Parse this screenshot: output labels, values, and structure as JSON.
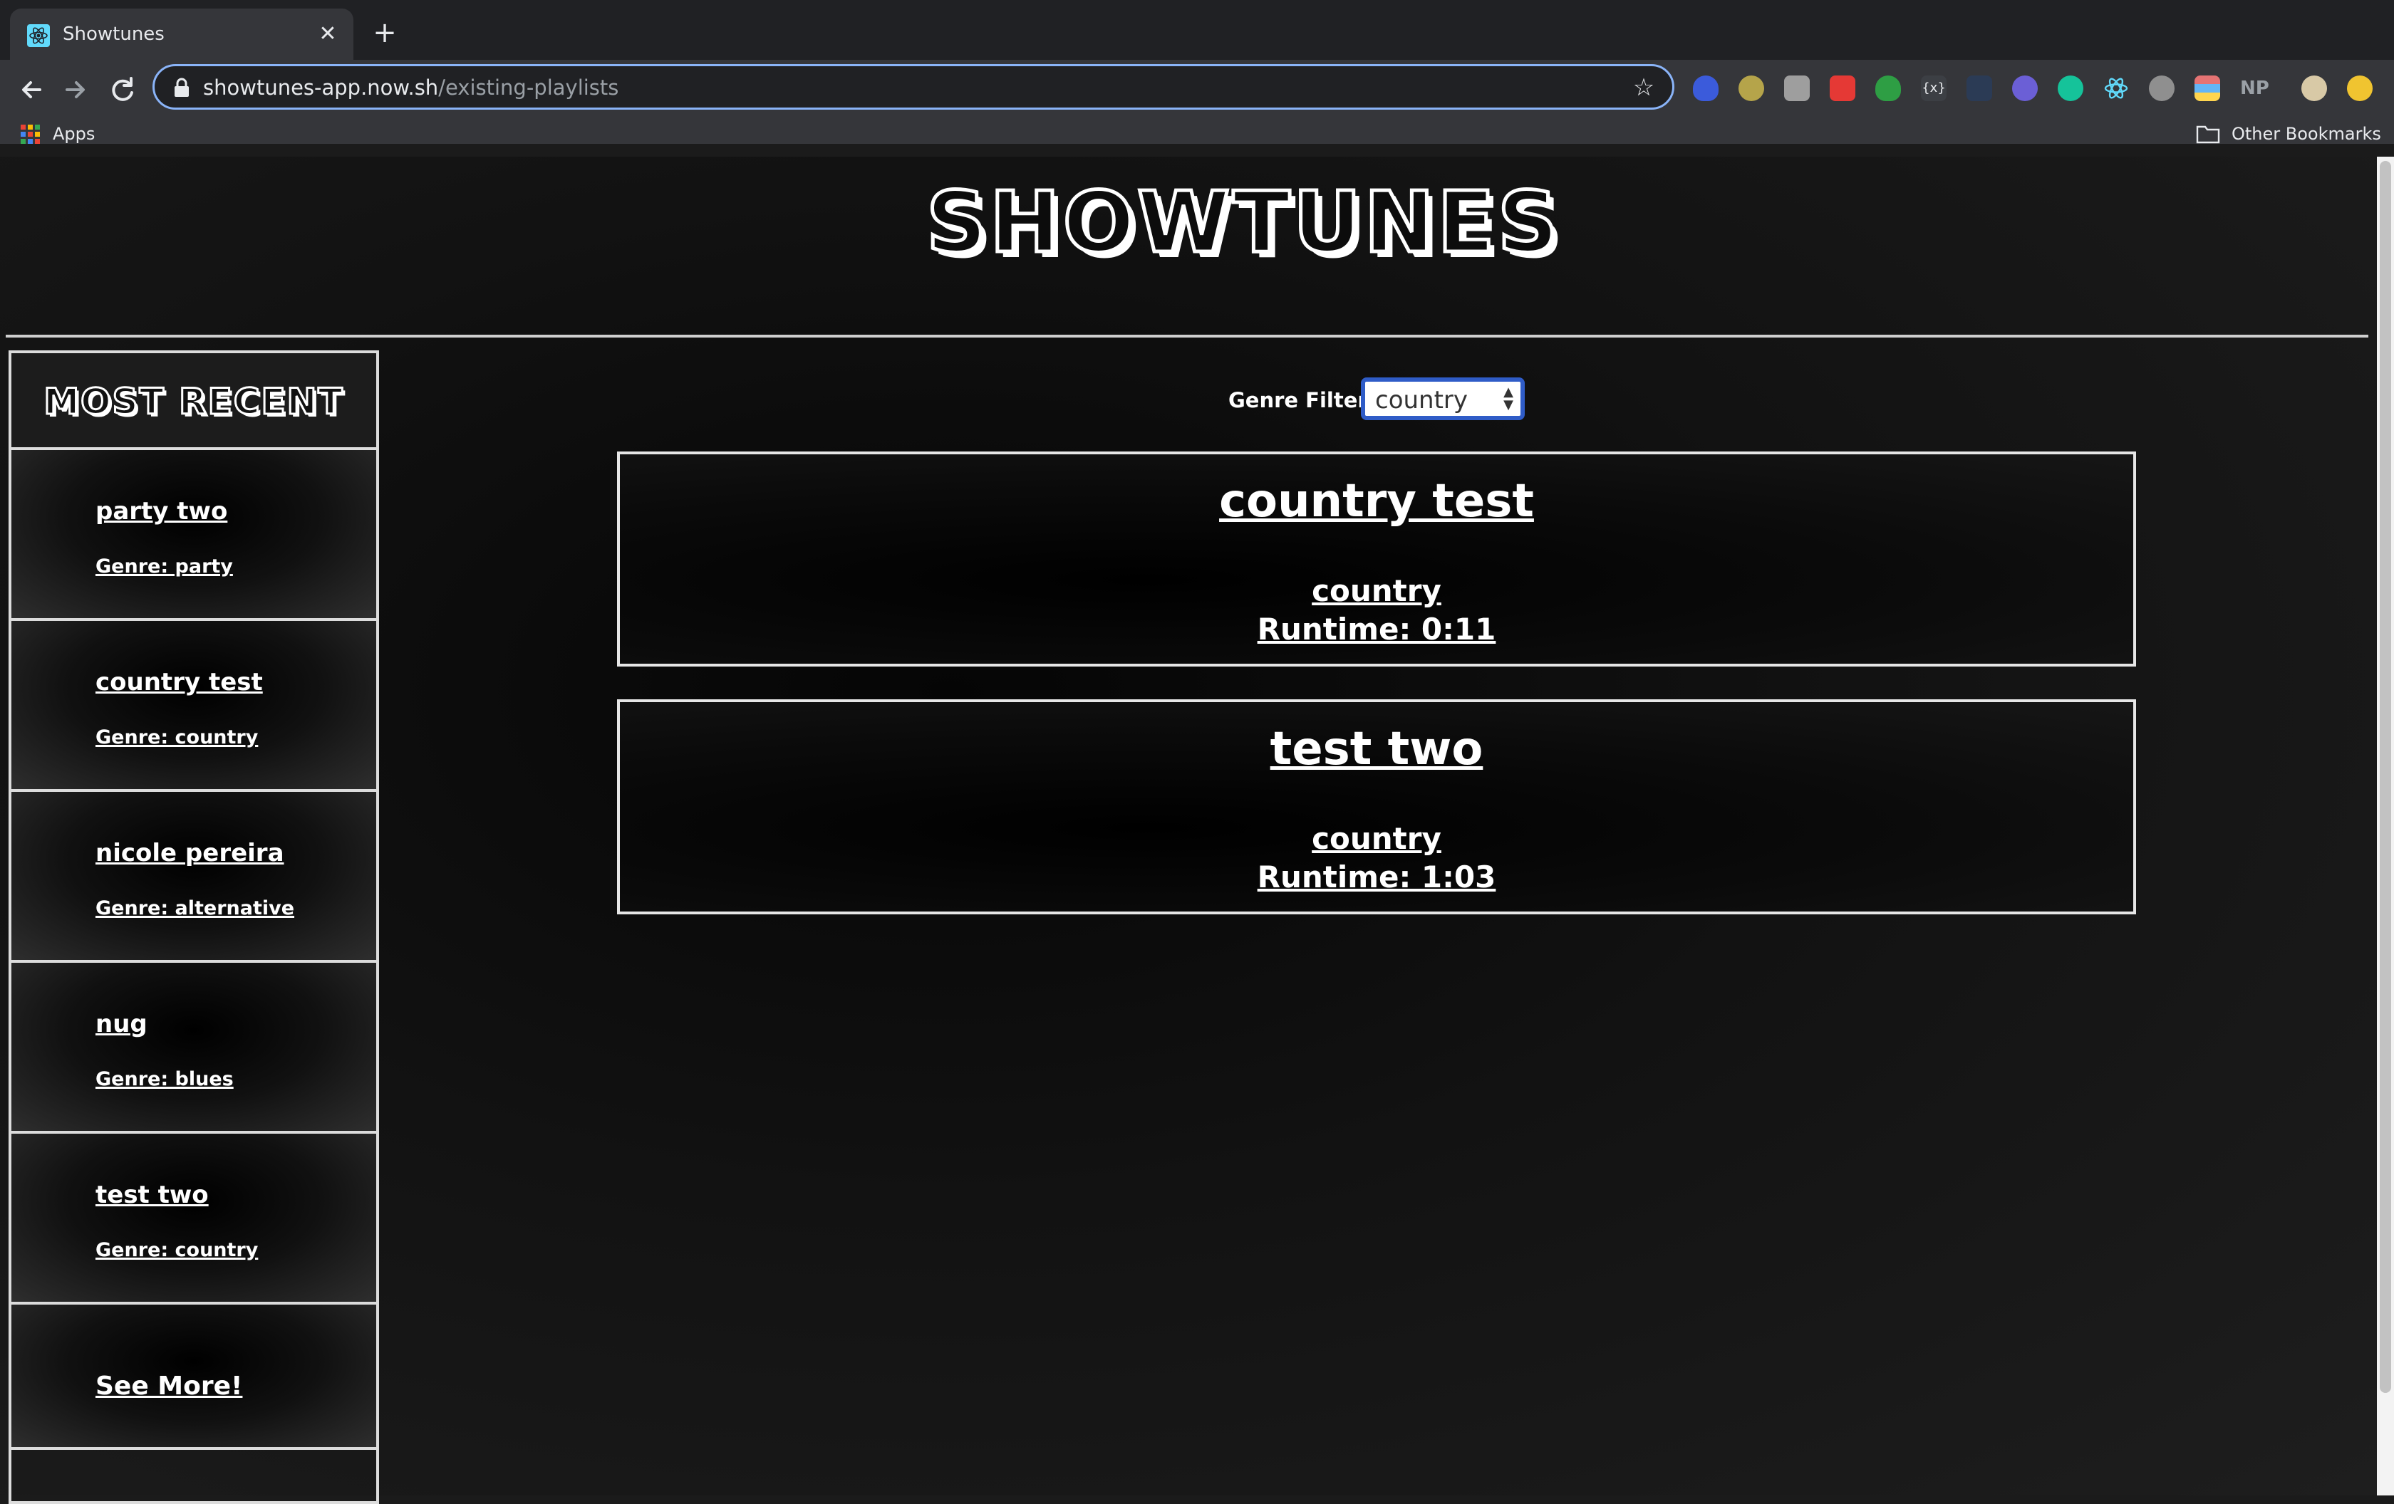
{
  "browser": {
    "tab_title": "Showtunes",
    "tab_close": "✕",
    "new_tab": "+",
    "url_host": "showtunes-app.now.sh",
    "url_path": "/existing-playlists",
    "bookmarks_apps": "Apps",
    "bookmarks_other": "Other Bookmarks",
    "extensions": [
      "shield-ext-icon",
      "ad-block-ext-icon",
      "puzzle-ext-icon",
      "pocket-ext-icon",
      "check-shield-ext-icon",
      "code-ext-icon",
      "typography-ext-icon",
      "disable-ext-icon",
      "grammarly-ext-icon",
      "react-devtools-icon",
      "speech-bubble-ext-icon",
      "colors-ext-icon",
      "np-ext-icon",
      "profile-avatar-icon",
      "extension-update-icon"
    ],
    "extension_np_label": "NP"
  },
  "site": {
    "logo": "SHOWTUNES"
  },
  "sidebar": {
    "title": "MOST RECENT",
    "items": [
      {
        "name": "party two",
        "genre": "Genre: party"
      },
      {
        "name": "country test",
        "genre": "Genre: country"
      },
      {
        "name": "nicole pereira",
        "genre": "Genre: alternative"
      },
      {
        "name": "nug",
        "genre": "Genre: blues"
      },
      {
        "name": "test two",
        "genre": "Genre: country"
      }
    ],
    "see_more": "See More!"
  },
  "filter": {
    "label": "Genre Filter:",
    "selected": "country"
  },
  "playlists": [
    {
      "title": "country test",
      "genre": "country",
      "runtime": "Runtime: 0:11"
    },
    {
      "title": "test two",
      "genre": "country",
      "runtime": "Runtime: 1:03"
    }
  ],
  "colors": {
    "page_bg": "#1b1b1b",
    "select_border": "#2f5cc7",
    "omnibox_focus": "#8ab4f8"
  }
}
